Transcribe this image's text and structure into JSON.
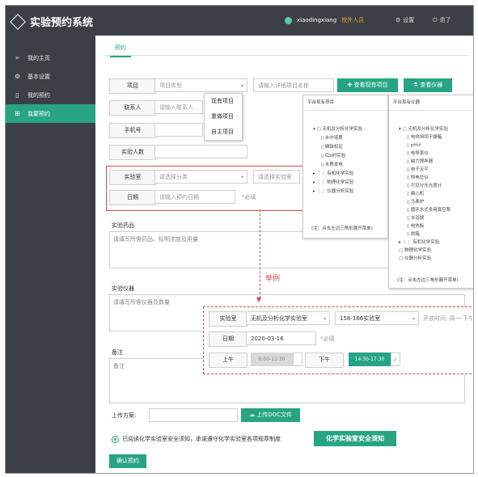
{
  "app": {
    "title": "实验预约系统"
  },
  "header": {
    "username": "xiaodingxiang",
    "role": "校外人员",
    "settings": "设置",
    "logout": "退了"
  },
  "sidebar": {
    "items": [
      {
        "label": "我的主页",
        "icon": "send-icon"
      },
      {
        "label": "基本设置",
        "icon": "gear-icon"
      },
      {
        "label": "我的预约",
        "icon": "document-icon"
      },
      {
        "label": "我要预约",
        "icon": "grid-icon"
      }
    ]
  },
  "tabs": {
    "active": "预约"
  },
  "form": {
    "project_label": "项目",
    "project_select": "项目类型",
    "project_detail_placeholder": "请输入详细项目名称",
    "btn_view_projects": "查看现有项目",
    "btn_view_instruments": "查看仪器",
    "contact_label": "联系人",
    "contact_placeholder": "请输入联系人",
    "phone_label": "手机号",
    "people_label": "实验人数",
    "lab_label": "实验室",
    "lab_select": "请选择分类",
    "lab_room_placeholder": "请选择实验室",
    "date_label": "日期",
    "date_placeholder": "请输入预约日期",
    "date_required": "*必填",
    "reagents_label": "实验药品",
    "reagents_placeholder": "请填写所需药品、标明浓度及用量",
    "instruments_label": "实验仪器",
    "instruments_placeholder": "请填写所需仪器及数量",
    "notes_label": "备注",
    "notes_placeholder": "备注",
    "upload_label": "上传方案:",
    "upload_btn": "上传DOC文件",
    "agree_text": "已阅读化学实验室安全须知，承诺遵守化学实验室各项规章制度",
    "safety_btn": "化学实验室安全须知",
    "submit_btn": "确认预约"
  },
  "project_type_dropdown": [
    "现有项目",
    "重做项目",
    "自主项目"
  ],
  "projects_panel": {
    "title": "平台现有项目",
    "items": [
      "无机及分析化学实验",
      "水中溶质",
      "磷钵权定",
      "红b时实验",
      "水质发电",
      "有机化学实验",
      "物理化学实验",
      "仪器分析实验"
    ],
    "note": "(注：点击左边三角形展开菜单)"
  },
  "instruments_panel": {
    "title": "平台现有仪器",
    "items": [
      "无机及分析化学实验",
      "电热恒同干燥箱",
      "pH计",
      "电导率仪",
      "磁力搅拌器",
      "电子天平",
      "恒电位仪",
      "可见分光光度计",
      "离心机",
      "马弗炉",
      "循环水式多用真空泵",
      "水浴锅",
      "电热板",
      "烘箱",
      "有机化学实验",
      "物理化学实验",
      "仪器分析实验"
    ],
    "note": "(注：点击左边三角形展开菜单)"
  },
  "example": {
    "label": "举例",
    "lab_label": "实验室",
    "lab_value": "无机及分析化学实验室",
    "room_value": "158-166实验室",
    "open_time": "开放时间: 周一-下午",
    "date_label": "日期",
    "date_value": "2020-03-16",
    "date_required": "*必填",
    "am_label": "上午",
    "am_slot": "8:00-11:30",
    "pm_label": "下午",
    "pm_slot": "14:30-17:30"
  },
  "colors": {
    "accent": "#27a483",
    "sidebar": "#3c4046",
    "highlight": "#d24a4a"
  }
}
